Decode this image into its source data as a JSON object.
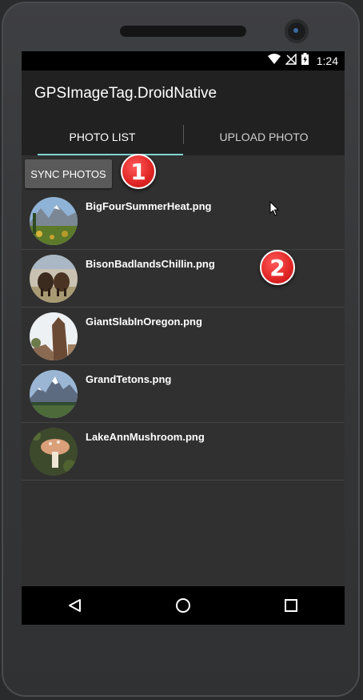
{
  "status": {
    "time": "1:24"
  },
  "app": {
    "title": "GPSImageTag.DroidNative"
  },
  "tabs": [
    {
      "label": "PHOTO LIST",
      "active": true
    },
    {
      "label": "UPLOAD PHOTO",
      "active": false
    }
  ],
  "toolbar": {
    "sync_label": "SYNC PHOTOS"
  },
  "annotations": {
    "badge1": "1",
    "badge2": "2",
    "color": "#e02424"
  },
  "photos": [
    {
      "name": "BigFourSummerHeat.png",
      "icon": "mountain-meadow-thumbnail"
    },
    {
      "name": "BisonBadlandsChillin.png",
      "icon": "bison-thumbnail"
    },
    {
      "name": "GiantSlabInOregon.png",
      "icon": "rock-slab-thumbnail"
    },
    {
      "name": "GrandTetons.png",
      "icon": "snow-mountains-thumbnail"
    },
    {
      "name": "LakeAnnMushroom.png",
      "icon": "mushroom-thumbnail"
    }
  ],
  "colors": {
    "tab_indicator": "#7fd6d3",
    "appbar": "#212121",
    "background": "#303030"
  }
}
